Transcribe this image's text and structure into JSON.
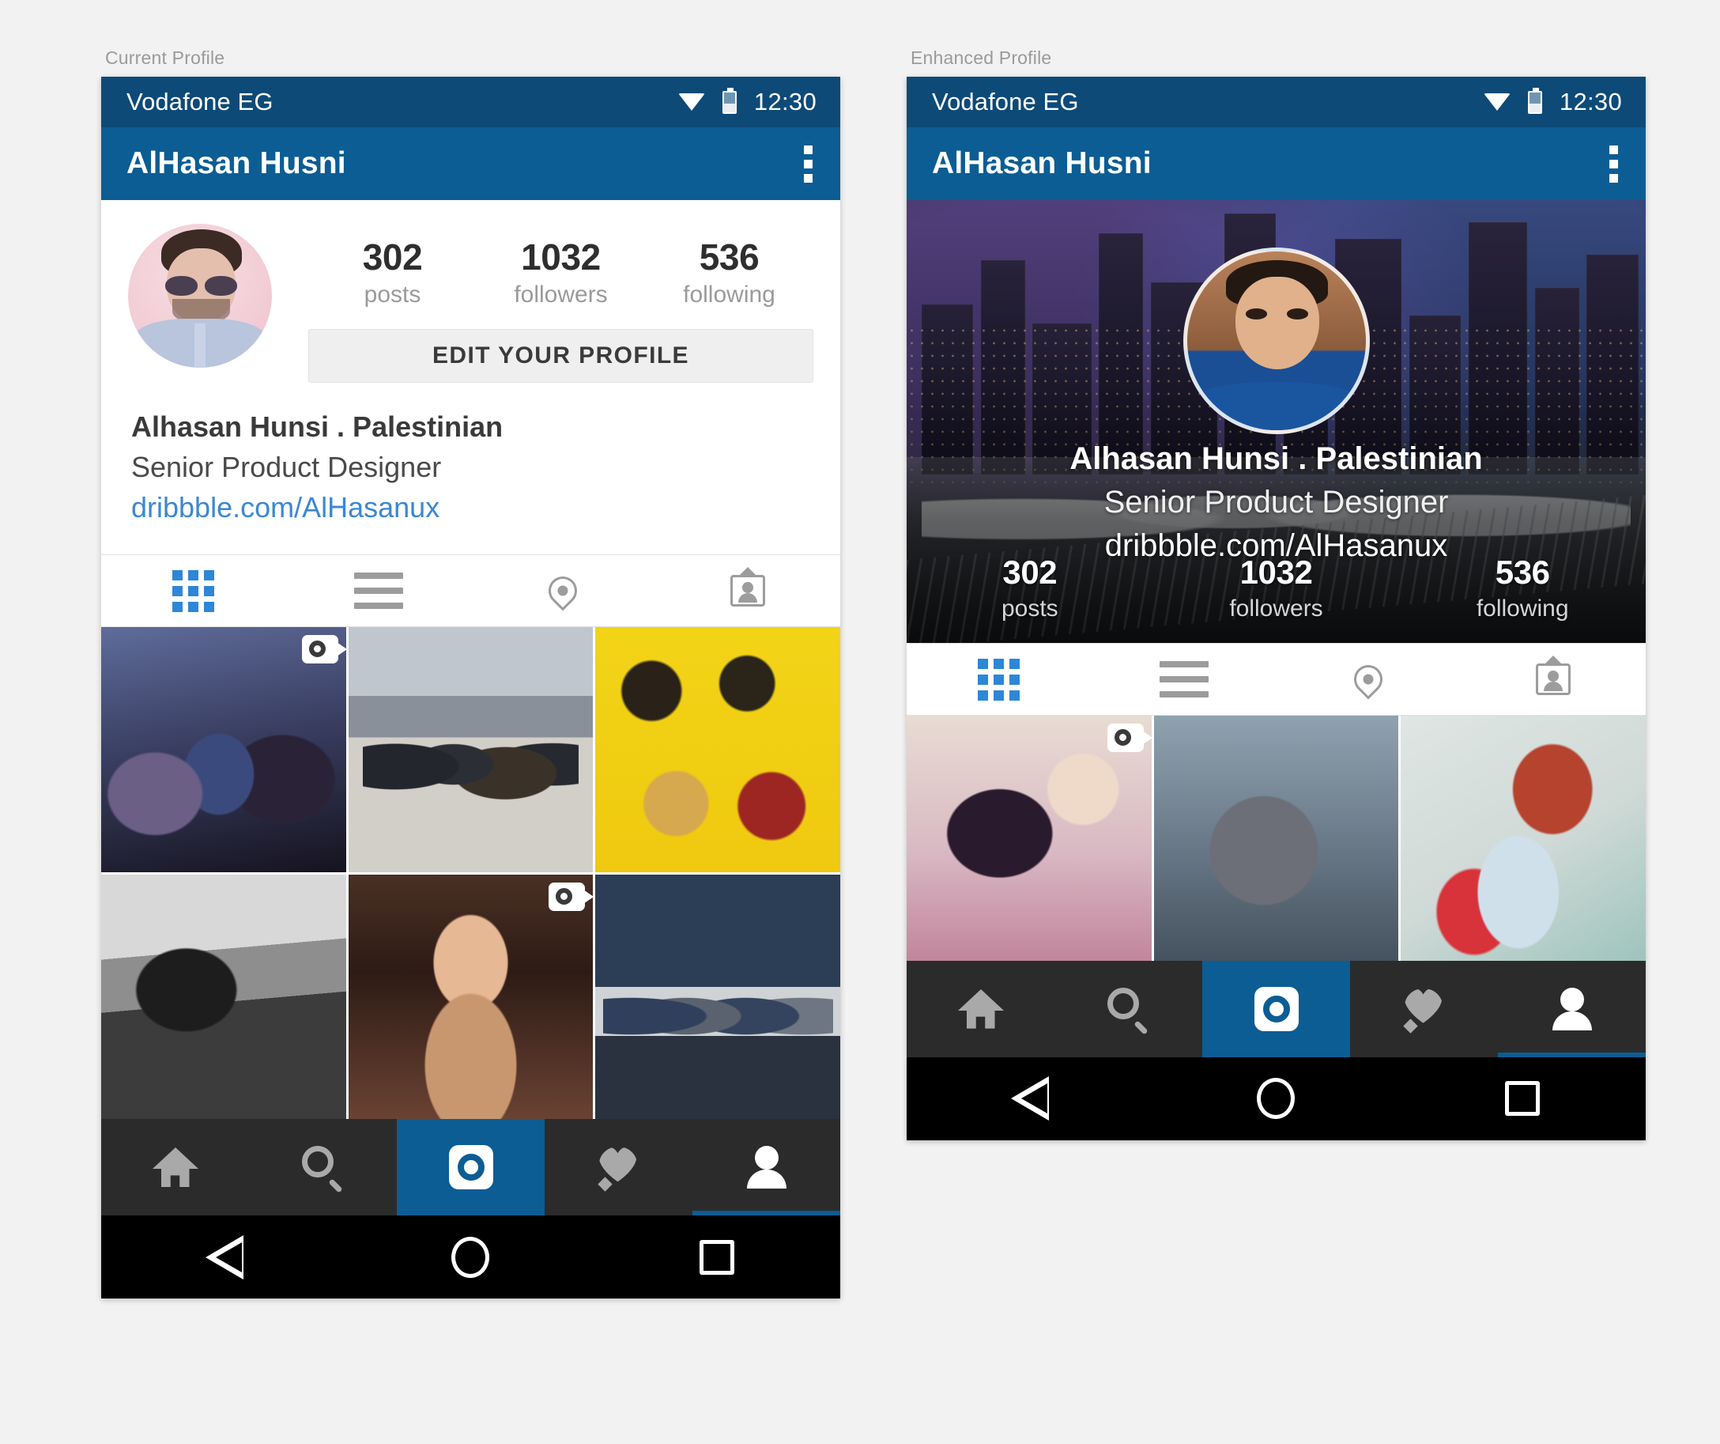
{
  "captions": {
    "left": "Current Profile",
    "right": "Enhanced Profile"
  },
  "status_bar": {
    "carrier": "Vodafone EG",
    "time": "12:30",
    "wifi_icon": "wifi-icon",
    "battery_icon": "battery-icon"
  },
  "app_bar": {
    "title": "AlHasan Husni",
    "overflow_icon": "overflow-menu-icon"
  },
  "profile": {
    "stats": [
      {
        "value": "302",
        "label": "posts"
      },
      {
        "value": "1032",
        "label": "followers"
      },
      {
        "value": "536",
        "label": "following"
      }
    ],
    "edit_button": "EDIT YOUR PROFILE",
    "bio": {
      "name": "Alhasan Hunsi . Palestinian",
      "role": "Senior Product Designer",
      "link": "dribbble.com/AlHasanux"
    },
    "avatar_icon": "profile-avatar"
  },
  "content_tabs": [
    {
      "name": "grid-tab",
      "icon": "grid-icon",
      "active": true
    },
    {
      "name": "list-tab",
      "icon": "list-icon",
      "active": false
    },
    {
      "name": "location-tab",
      "icon": "location-pin-icon",
      "active": false
    },
    {
      "name": "tagged-tab",
      "icon": "tagged-photos-icon",
      "active": false
    }
  ],
  "grid_left": [
    {
      "name": "photo-band-neon",
      "video": true
    },
    {
      "name": "photo-band-rooftop",
      "video": false
    },
    {
      "name": "photo-band-yellow",
      "video": false
    },
    {
      "name": "photo-stage-bw",
      "video": false
    },
    {
      "name": "photo-portrait",
      "video": true
    },
    {
      "name": "photo-bar-group",
      "video": false
    }
  ],
  "grid_right": [
    {
      "name": "photo-sweets-woman",
      "video": true
    },
    {
      "name": "photo-fur-woman",
      "video": false
    },
    {
      "name": "photo-fashion-man",
      "video": false
    }
  ],
  "bottom_nav": [
    {
      "name": "home-tab",
      "icon": "home-icon",
      "state": "inactive"
    },
    {
      "name": "search-tab",
      "icon": "search-icon",
      "state": "inactive"
    },
    {
      "name": "camera-tab",
      "icon": "camera-icon",
      "state": "active-filled"
    },
    {
      "name": "activity-tab",
      "icon": "heart-icon",
      "state": "inactive"
    },
    {
      "name": "profile-tab",
      "icon": "person-icon",
      "state": "active-underline"
    }
  ],
  "system_nav": [
    {
      "name": "back-button",
      "icon": "triangle-back-icon"
    },
    {
      "name": "home-button",
      "icon": "circle-home-icon"
    },
    {
      "name": "recents-button",
      "icon": "square-recents-icon"
    }
  ],
  "colors": {
    "status_bar": "#0d4a78",
    "app_bar": "#0b5d94",
    "accent": "#2d87d8",
    "link": "#3b87d4",
    "bottom_nav": "#2b2b2b",
    "page_bg": "#f2f2f2"
  },
  "hero": {
    "background_icon": "dubai-marina-night-photo",
    "avatar_icon": "hero-profile-avatar"
  }
}
